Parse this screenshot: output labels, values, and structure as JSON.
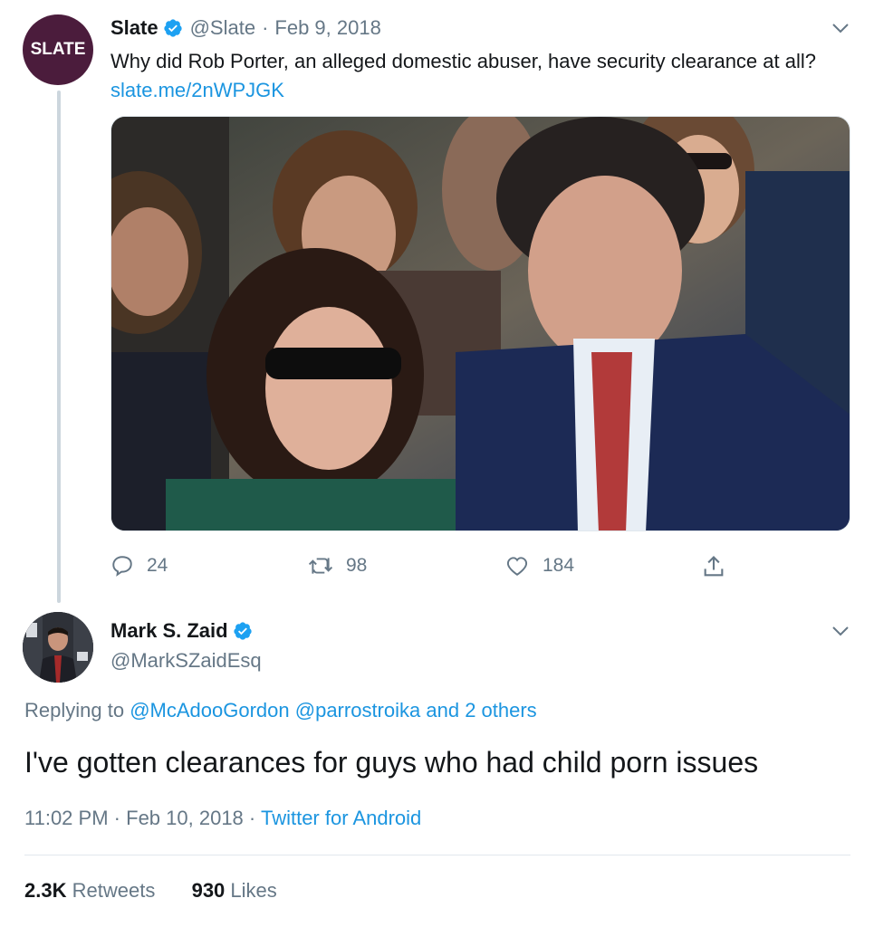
{
  "tweet1": {
    "avatar_text": "SLATE",
    "name": "Slate",
    "handle": "@Slate",
    "separator": "·",
    "date": "Feb 9, 2018",
    "text": "Why did Rob Porter, an alleged domestic abuser, have security clearance at all?",
    "link": "slate.me/2nWPJGK",
    "replies": "24",
    "retweets": "98",
    "likes": "184"
  },
  "tweet2": {
    "name": "Mark S. Zaid",
    "handle": "@MarkSZaidEsq",
    "replying_prefix": "Replying to",
    "replying_user1": "@McAdooGordon",
    "replying_user2": "@parrostroika",
    "replying_more": "and 2 others",
    "text": "I've gotten clearances for guys who had child porn issues",
    "time": "11:02 PM",
    "separator": "·",
    "date": "Feb 10, 2018",
    "source": "Twitter for Android",
    "retweet_count": "2.3K",
    "retweet_label": "Retweets",
    "like_count": "930",
    "like_label": "Likes"
  },
  "icons": {
    "verified": "verified-badge-icon",
    "caret": "chevron-down-icon",
    "reply": "reply-icon",
    "retweet": "retweet-icon",
    "like": "heart-icon",
    "share": "share-icon"
  },
  "colors": {
    "link": "#1b95e0",
    "muted": "#657786",
    "text": "#14171a",
    "slate_brand": "#4b1c3c",
    "thread_line": "#ccd6dd"
  }
}
